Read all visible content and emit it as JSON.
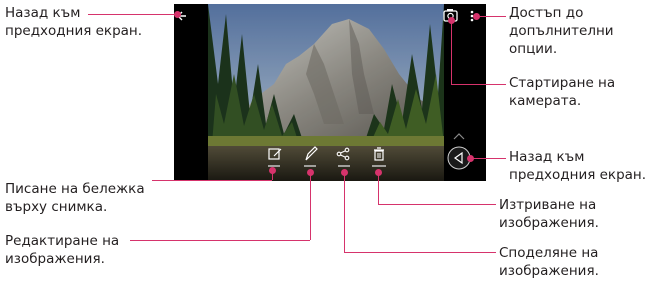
{
  "callouts": {
    "back_top": "Назад към\nпредходния екран.",
    "more_options": "Достъп до\nдопълнителни\nопции.",
    "camera": "Стартиране на\nкамерата.",
    "back_right": "Назад към\nпредходния екран.",
    "memo": "Писане на бележка\nвърху снимка.",
    "edit": "Редактиране на\nизображения.",
    "delete": "Изтриване на\nизображения.",
    "share": "Споделяне на\nизображения."
  },
  "photo": {
    "subject": "mountain-valley-forest-landscape",
    "toolbar_labels": [
      "Memo",
      "Edit",
      "Share",
      "Delete"
    ]
  },
  "icons": {
    "back_arrow": "back-arrow-icon",
    "camera": "camera-icon",
    "more": "more-vertical-icon",
    "memo": "note-pencil-icon",
    "edit": "pencil-icon",
    "share": "share-icon",
    "delete": "trash-icon",
    "nav_back": "nav-back-triangle-icon",
    "expand": "chevron-up-icon"
  },
  "colors": {
    "leader": "#d6336c",
    "text": "#231f20"
  }
}
